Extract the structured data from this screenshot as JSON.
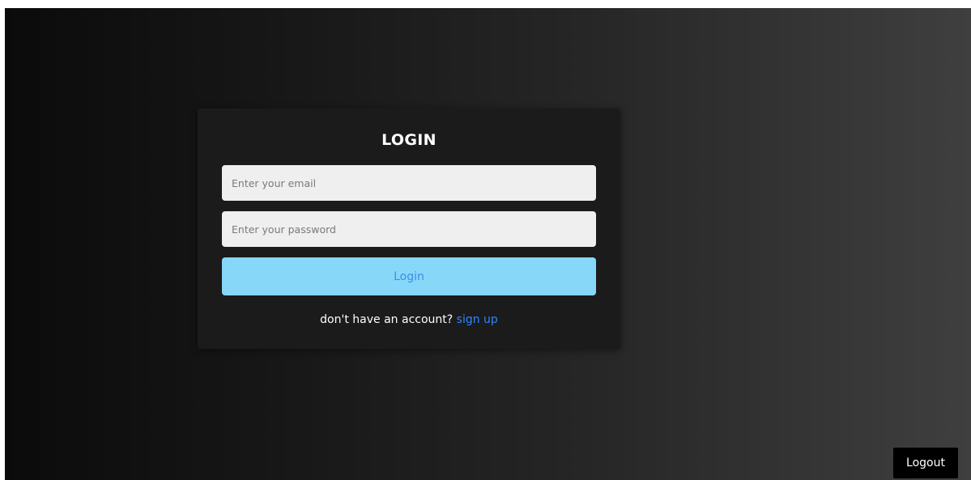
{
  "login_form": {
    "title": "LOGIN",
    "email_placeholder": "Enter your email",
    "email_value": "",
    "password_placeholder": "Enter your password",
    "password_value": "",
    "submit_label": "Login",
    "signup_prompt": "don't have an account?",
    "signup_link": "sign up"
  },
  "header": {
    "logout_label": "Logout"
  },
  "colors": {
    "login_button_bg": "#87d7f9",
    "login_button_text": "#3d8de6",
    "link": "#2f85ff",
    "card_bg": "#1b1b1b",
    "input_bg": "#efefef",
    "logout_bg": "#000000"
  }
}
